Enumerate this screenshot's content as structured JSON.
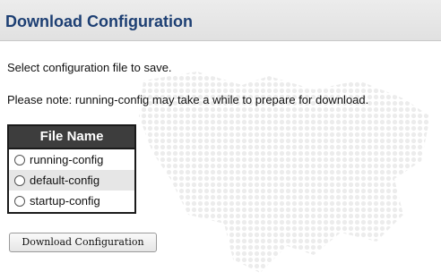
{
  "header": {
    "title": "Download Configuration"
  },
  "content": {
    "instruction": "Select configuration file to save.",
    "note": "Please note: running-config may take a while to prepare for download."
  },
  "file_table": {
    "header": "File Name",
    "options": [
      {
        "label": "running-config",
        "selected": false
      },
      {
        "label": "default-config",
        "selected": false
      },
      {
        "label": "startup-config",
        "selected": false
      }
    ]
  },
  "buttons": {
    "download_label": "Download Configuration"
  },
  "colors": {
    "title": "#1d3f73",
    "header_bg": "#e6e6e6",
    "table_header_bg": "#3d3d3d",
    "map_dots": "#efefef"
  }
}
